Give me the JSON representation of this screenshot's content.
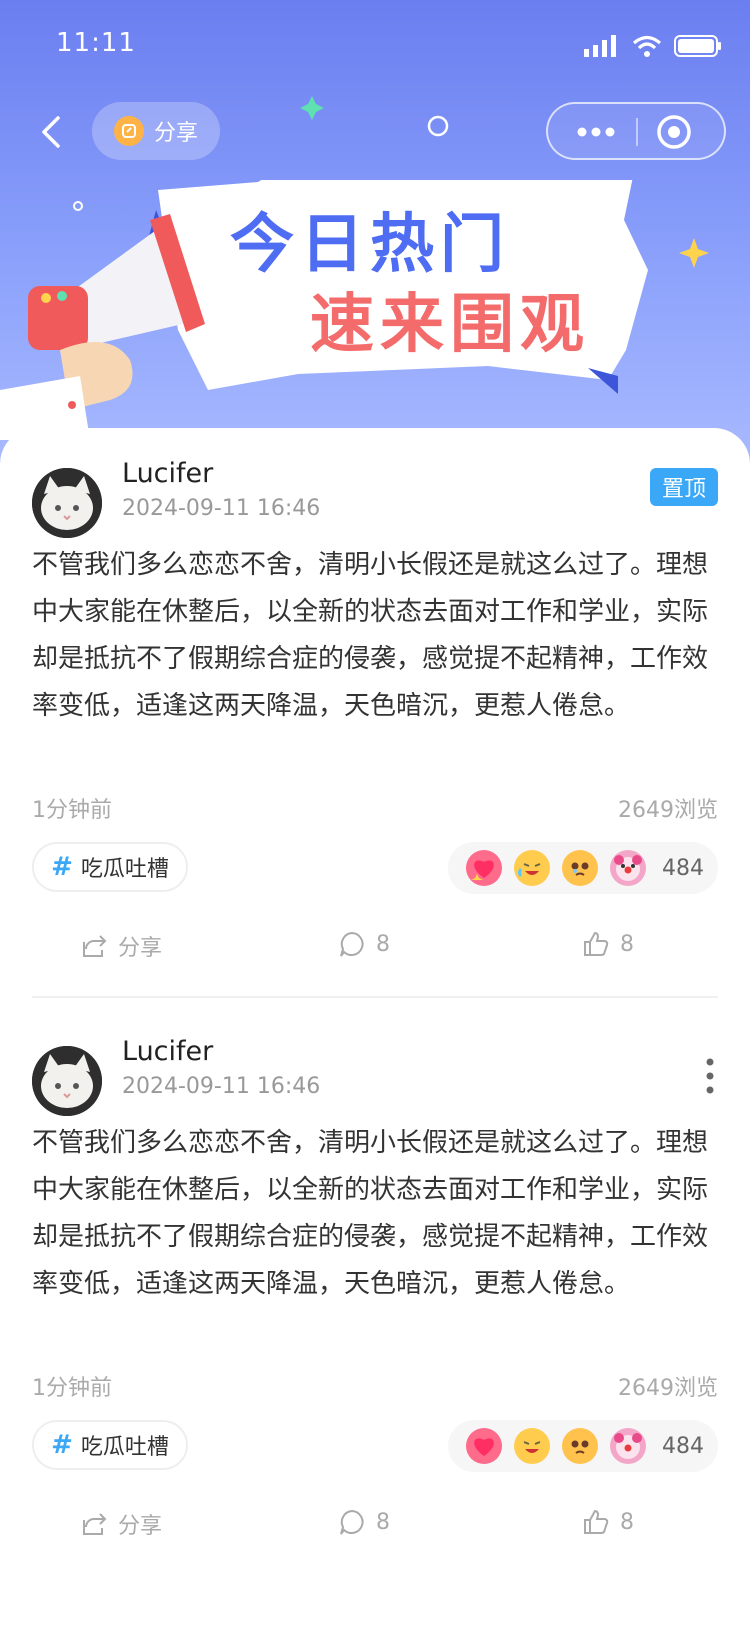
{
  "status": {
    "time": "11:11"
  },
  "nav": {
    "share_label": "分享"
  },
  "banner": {
    "line1": "今日热门",
    "line2": "速来围观"
  },
  "colors": {
    "accent": "#3aa7f7",
    "banner_blue": "#4e6df2",
    "banner_red": "#f46b6b"
  },
  "posts": [
    {
      "author": "Lucifer",
      "date": "2024-09-11 16:46",
      "badge": "置顶",
      "text": "不管我们多么恋恋不舍，清明小长假还是就这么过了。理想中大家能在休整后，以全新的状态去面对工作和学业，实际却是抵抗不了假期综合症的侵袭，感觉提不起精神，工作效率变低，适逢这两天降温，天色暗沉，更惹人倦怠。",
      "time_ago": "1分钟前",
      "views": "2649浏览",
      "tag": "吃瓜吐槽",
      "reaction_count": "484",
      "share_label": "分享",
      "comments": "8",
      "likes": "8"
    },
    {
      "author": "Lucifer",
      "date": "2024-09-11 16:46",
      "text": "不管我们多么恋恋不舍，清明小长假还是就这么过了。理想中大家能在休整后，以全新的状态去面对工作和学业，实际却是抵抗不了假期综合症的侵袭，感觉提不起精神，工作效率变低，适逢这两天降温，天色暗沉，更惹人倦怠。",
      "time_ago": "1分钟前",
      "views": "2649浏览",
      "tag": "吃瓜吐槽",
      "reaction_count": "484",
      "share_label": "分享",
      "comments": "8",
      "likes": "8"
    }
  ]
}
